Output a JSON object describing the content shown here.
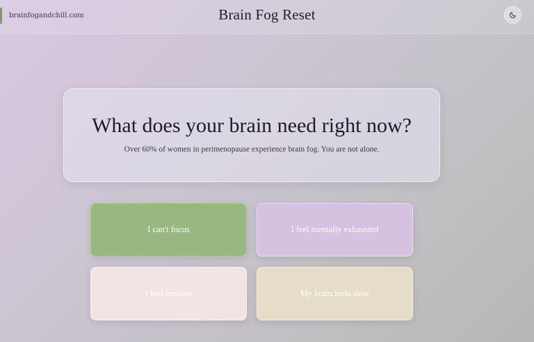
{
  "header": {
    "site_link": "brainfogandchill.com",
    "title": "Brain Fog Reset",
    "theme_toggle_icon": "moon-icon"
  },
  "hero": {
    "title": "What does your brain need right now?",
    "subtitle": "Over 60% of women in perimenopause experience brain fog. You are not alone."
  },
  "options": [
    {
      "label": "I can't focus",
      "color": "#98b880"
    },
    {
      "label": "I feel mentally exhausted",
      "color": "#d4c2e0"
    },
    {
      "label": "I feel anxious",
      "color": "#f2e4e2"
    },
    {
      "label": "My brain feels slow",
      "color": "#e6ddc8"
    }
  ],
  "colors": {
    "accent_green": "#98b880",
    "text_dark": "#1e1a2e",
    "background_start": "#d8c8e2",
    "background_end": "#b7b8b5"
  }
}
